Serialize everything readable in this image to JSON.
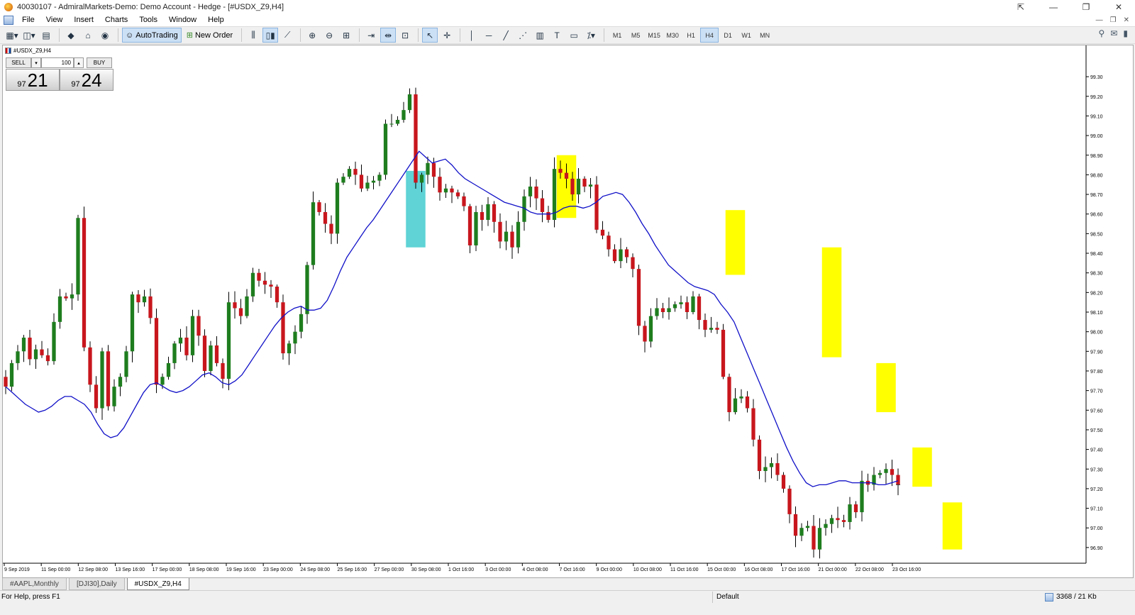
{
  "window": {
    "title": "40030107 - AdmiralMarkets-Demo: Demo Account - Hedge - [#USDX_Z9,H4]",
    "controls": [
      "⇱",
      "—",
      "❐",
      "✕"
    ]
  },
  "menu": {
    "items": [
      "File",
      "View",
      "Insert",
      "Charts",
      "Tools",
      "Window",
      "Help"
    ],
    "doc_controls": [
      "—",
      "❐",
      "✕"
    ]
  },
  "toolbar": {
    "autotrading_label": "AutoTrading",
    "new_order_label": "New Order",
    "timeframes": [
      "M1",
      "M5",
      "M15",
      "M30",
      "H1",
      "H4",
      "D1",
      "W1",
      "MN"
    ],
    "active_timeframe": "H4"
  },
  "chart": {
    "header_label": "#USDX_Z9,H4",
    "one_click": {
      "sell_label": "SELL",
      "buy_label": "BUY",
      "volume": "100",
      "sell_price_small": "97",
      "sell_price_big": "21",
      "buy_price_small": "97",
      "buy_price_big": "24"
    }
  },
  "chart_data": {
    "type": "candlestick",
    "symbol": "#USDX_Z9",
    "timeframe": "H4",
    "ylim": [
      96.82,
      99.38
    ],
    "y_ticks": [
      "99.30",
      "99.20",
      "99.10",
      "99.00",
      "98.90",
      "98.80",
      "98.70",
      "98.60",
      "98.50",
      "98.40",
      "98.30",
      "98.20",
      "98.10",
      "98.00",
      "97.90",
      "97.80",
      "97.70",
      "97.60",
      "97.50",
      "97.40",
      "97.30",
      "97.20",
      "97.10",
      "97.00",
      "96.90"
    ],
    "x_ticks": [
      "9 Sep 2019",
      "11 Sep 00:00",
      "12 Sep 08:00",
      "13 Sep 16:00",
      "17 Sep 00:00",
      "18 Sep 08:00",
      "19 Sep 16:00",
      "23 Sep 00:00",
      "24 Sep 08:00",
      "25 Sep 16:00",
      "27 Sep 00:00",
      "30 Sep 08:00",
      "1 Oct 16:00",
      "3 Oct 00:00",
      "4 Oct 08:00",
      "7 Oct 16:00",
      "9 Oct 00:00",
      "10 Oct 08:00",
      "11 Oct 16:00",
      "15 Oct 00:00",
      "16 Oct 08:00",
      "17 Oct 16:00",
      "21 Oct 00:00",
      "22 Oct 08:00",
      "23 Oct 16:00"
    ],
    "candle_colors": {
      "bull": "#1e7d1e",
      "bear": "#c8161d"
    },
    "ma_color": "#1010c8",
    "closes": [
      97.72,
      97.84,
      97.9,
      97.97,
      97.86,
      97.91,
      97.88,
      97.85,
      98.05,
      98.18,
      98.17,
      98.19,
      98.58,
      97.92,
      97.73,
      97.61,
      97.9,
      97.62,
      97.72,
      97.77,
      97.9,
      98.19,
      98.15,
      98.18,
      98.07,
      97.73,
      97.77,
      97.84,
      97.94,
      97.97,
      97.88,
      98.08,
      97.98,
      97.8,
      97.93,
      97.84,
      97.76,
      98.15,
      98.12,
      98.08,
      98.18,
      98.3,
      98.26,
      98.24,
      98.23,
      98.15,
      97.89,
      97.94,
      98.0,
      98.09,
      98.34,
      98.66,
      98.61,
      98.55,
      98.5,
      98.76,
      98.79,
      98.83,
      98.8,
      98.73,
      98.76,
      98.77,
      98.8,
      99.06,
      99.06,
      99.08,
      99.13,
      99.21,
      98.76,
      98.8,
      98.86,
      98.79,
      98.71,
      98.73,
      98.71,
      98.69,
      98.64,
      98.44,
      98.61,
      98.57,
      98.65,
      98.56,
      98.46,
      98.51,
      98.43,
      98.56,
      98.69,
      98.74,
      98.68,
      98.61,
      98.57,
      98.83,
      98.81,
      98.78,
      98.7,
      98.78,
      98.74,
      98.75,
      98.52,
      98.49,
      98.42,
      98.36,
      98.42,
      98.38,
      98.32,
      98.03,
      97.95,
      98.08,
      98.12,
      98.1,
      98.12,
      98.14,
      98.15,
      98.1,
      98.18,
      98.06,
      98.01,
      98.02,
      98.01,
      97.77,
      97.59,
      97.66,
      97.67,
      97.61,
      97.45,
      97.29,
      97.31,
      97.33,
      97.27,
      97.2,
      97.07,
      96.96,
      97.0,
      97.01,
      96.89,
      97.0,
      97.02,
      97.05,
      97.04,
      97.03,
      97.12,
      97.08,
      97.24,
      97.22,
      97.27,
      97.28,
      97.3,
      97.27,
      97.22
    ],
    "ma": [
      97.72,
      97.69,
      97.66,
      97.63,
      97.61,
      97.59,
      97.6,
      97.62,
      97.65,
      97.67,
      97.67,
      97.65,
      97.63,
      97.59,
      97.53,
      97.48,
      97.46,
      97.47,
      97.51,
      97.57,
      97.63,
      97.69,
      97.73,
      97.74,
      97.72,
      97.7,
      97.69,
      97.7,
      97.72,
      97.75,
      97.78,
      97.79,
      97.77,
      97.74,
      97.73,
      97.75,
      97.78,
      97.83,
      97.88,
      97.93,
      97.98,
      98.03,
      98.07,
      98.1,
      98.12,
      98.13,
      98.11,
      98.11,
      98.12,
      98.16,
      98.23,
      98.31,
      98.38,
      98.43,
      98.48,
      98.53,
      98.57,
      98.62,
      98.67,
      98.72,
      98.77,
      98.82,
      98.87,
      98.92,
      98.89,
      98.86,
      98.87,
      98.88,
      98.85,
      98.81,
      98.78,
      98.76,
      98.74,
      98.72,
      98.7,
      98.68,
      98.66,
      98.65,
      98.64,
      98.63,
      98.61,
      98.6,
      98.6,
      98.6,
      98.61,
      98.63,
      98.64,
      98.64,
      98.63,
      98.64,
      98.66,
      98.69,
      98.7,
      98.71,
      98.7,
      98.66,
      98.61,
      98.55,
      98.5,
      98.44,
      98.39,
      98.34,
      98.31,
      98.28,
      98.25,
      98.23,
      98.22,
      98.21,
      98.19,
      98.14,
      98.1,
      98.05,
      97.97,
      97.89,
      97.81,
      97.73,
      97.65,
      97.57,
      97.49,
      97.41,
      97.34,
      97.28,
      97.23,
      97.21,
      97.22,
      97.22,
      97.23,
      97.24,
      97.24,
      97.23,
      97.23,
      97.23,
      97.23,
      97.22,
      97.22,
      97.23,
      97.24
    ],
    "highlights": [
      {
        "color": "cyan",
        "from_bar": 67,
        "to_bar": 69,
        "low": 98.43,
        "high": 98.82
      },
      {
        "color": "yellow",
        "from_bar": 92,
        "to_bar": 94,
        "low": 98.58,
        "high": 98.9
      },
      {
        "color": "yellow",
        "from_bar": 120,
        "to_bar": 122,
        "low": 98.29,
        "high": 98.62
      },
      {
        "color": "yellow",
        "from_bar": 136,
        "to_bar": 138,
        "low": 97.87,
        "high": 98.43
      },
      {
        "color": "yellow",
        "from_bar": 145,
        "to_bar": 147,
        "low": 97.59,
        "high": 97.84
      },
      {
        "color": "yellow",
        "from_bar": 151,
        "to_bar": 153,
        "low": 97.21,
        "high": 97.41
      },
      {
        "color": "yellow",
        "from_bar": 156,
        "to_bar": 158,
        "low": 96.89,
        "high": 97.13
      }
    ]
  },
  "tabs": [
    {
      "label": "#AAPL,Monthly",
      "active": false
    },
    {
      "label": "[DJI30],Daily",
      "active": false
    },
    {
      "label": "#USDX_Z9,H4",
      "active": true
    }
  ],
  "status": {
    "help": "For Help, press F1",
    "profile": "Default",
    "traffic": "3368 / 21 Kb"
  }
}
